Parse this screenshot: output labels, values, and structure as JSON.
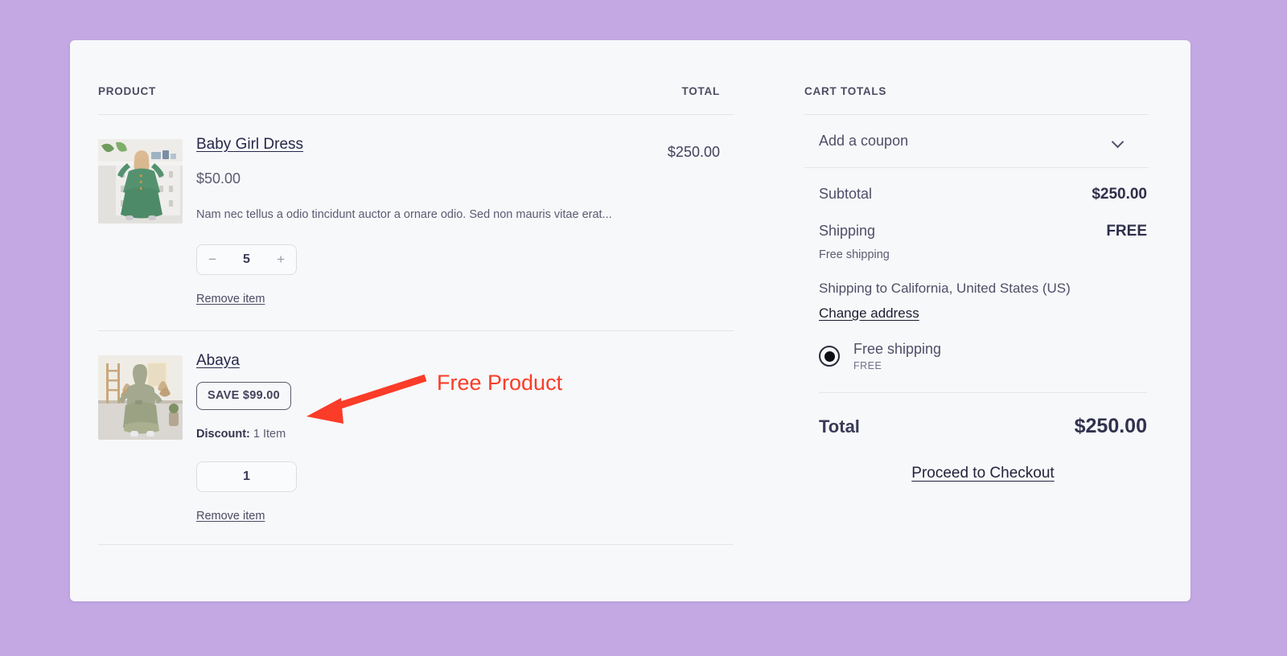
{
  "theme": {
    "page_background": "#c4a8e4",
    "card_background": "#f7f8fa",
    "divider": "#e3e5e9",
    "annotation_color": "#fa3c28"
  },
  "products_panel": {
    "header": {
      "product_label": "PRODUCT",
      "total_label": "TOTAL"
    },
    "items": [
      {
        "name": "Baby Girl Dress",
        "price": "$50.00",
        "description": "Nam nec tellus a odio tincidunt auctor a ornare odio. Sed non mauris vitae erat...",
        "quantity": "5",
        "decrease_label": "−",
        "increase_label": "+",
        "remove_label": "Remove item",
        "line_total": "$250.00",
        "thumbnail": "baby-girl-dress-photo"
      },
      {
        "name": "Abaya",
        "save_badge": "SAVE $99.00",
        "discount_label": "Discount:",
        "discount_value": "1 Item",
        "quantity": "1",
        "remove_label": "Remove item",
        "line_total": "",
        "thumbnail": "abaya-photo"
      }
    ]
  },
  "totals_panel": {
    "title": "CART TOTALS",
    "coupon": {
      "label": "Add a coupon",
      "chevron": "chevron-down-icon"
    },
    "subtotal": {
      "label": "Subtotal",
      "value": "$250.00"
    },
    "shipping": {
      "label": "Shipping",
      "value": "FREE",
      "note": "Free shipping",
      "ship_to": "Shipping to California, United States (US)",
      "change_address": "Change address",
      "option_name": "Free shipping",
      "option_price": "FREE"
    },
    "total": {
      "label": "Total",
      "value": "$250.00"
    },
    "checkout_label": "Proceed to Checkout"
  },
  "annotation": {
    "text": "Free Product"
  }
}
